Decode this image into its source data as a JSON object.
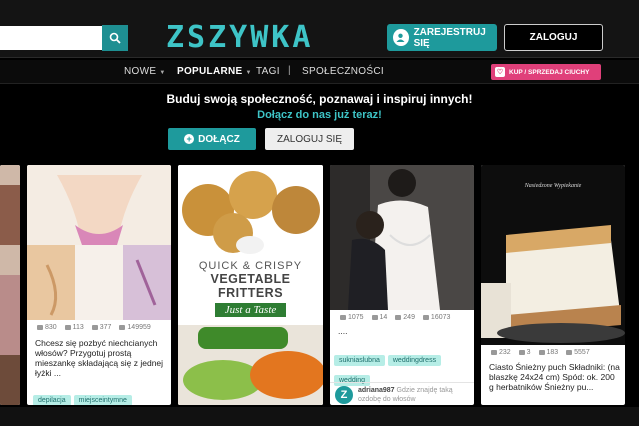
{
  "header": {
    "search_placeholder": "",
    "logo": "ZSZYWKA",
    "register_label": "ZAREJESTRUJ SIĘ",
    "login_label": "ZALOGUJ"
  },
  "nav": {
    "items": [
      "NOWE",
      "POPULARNE",
      "TAGI",
      "SPOŁECZNOŚCI"
    ],
    "sell_label": "KUP / SPRZEDAJ CIUCHY"
  },
  "hero": {
    "title": "Buduj swoją społeczność, poznawaj i inspiruj innych!",
    "subtitle": "Dołącz do nas już teraz!",
    "join_label": "DOŁĄCZ",
    "login_label": "ZALOGUJ SIĘ"
  },
  "cards": [
    {
      "stats": [
        "830",
        "113",
        "377",
        "149959"
      ],
      "description": "Chcesz się pozbyć niechcianych włosów? Przygotuj prostą mieszankę składającą się z jednej łyżki ...",
      "tags": [
        "depilacja",
        "miejsceintymne"
      ]
    },
    {
      "image_text_1": "QUICK & CRISPY",
      "image_text_2": "VEGETABLE FRITTERS",
      "image_text_3": "Just a Taste"
    },
    {
      "stats": [
        "1075",
        "14",
        "249",
        "16073"
      ],
      "description": "....",
      "tags": [
        "sukniaslubna",
        "weddingdress",
        "wedding"
      ],
      "user": "adriana987",
      "user_text": "Gdzie znajdę taką ozdobę do włosów"
    },
    {
      "image_caption": "Nasiedzone Wypiekanie",
      "stats": [
        "232",
        "3",
        "183",
        "5557"
      ],
      "description": "Ciasto Śnieżny puch Składniki: (na blaszkę 24x24 cm) Spód: ok. 200 g herbatników Śnieżny pu..."
    }
  ],
  "colors": {
    "accent": "#1e9a9c",
    "logo": "#3ec4c7",
    "sell": "#e0407a",
    "tag_bg": "#b6ede6"
  }
}
